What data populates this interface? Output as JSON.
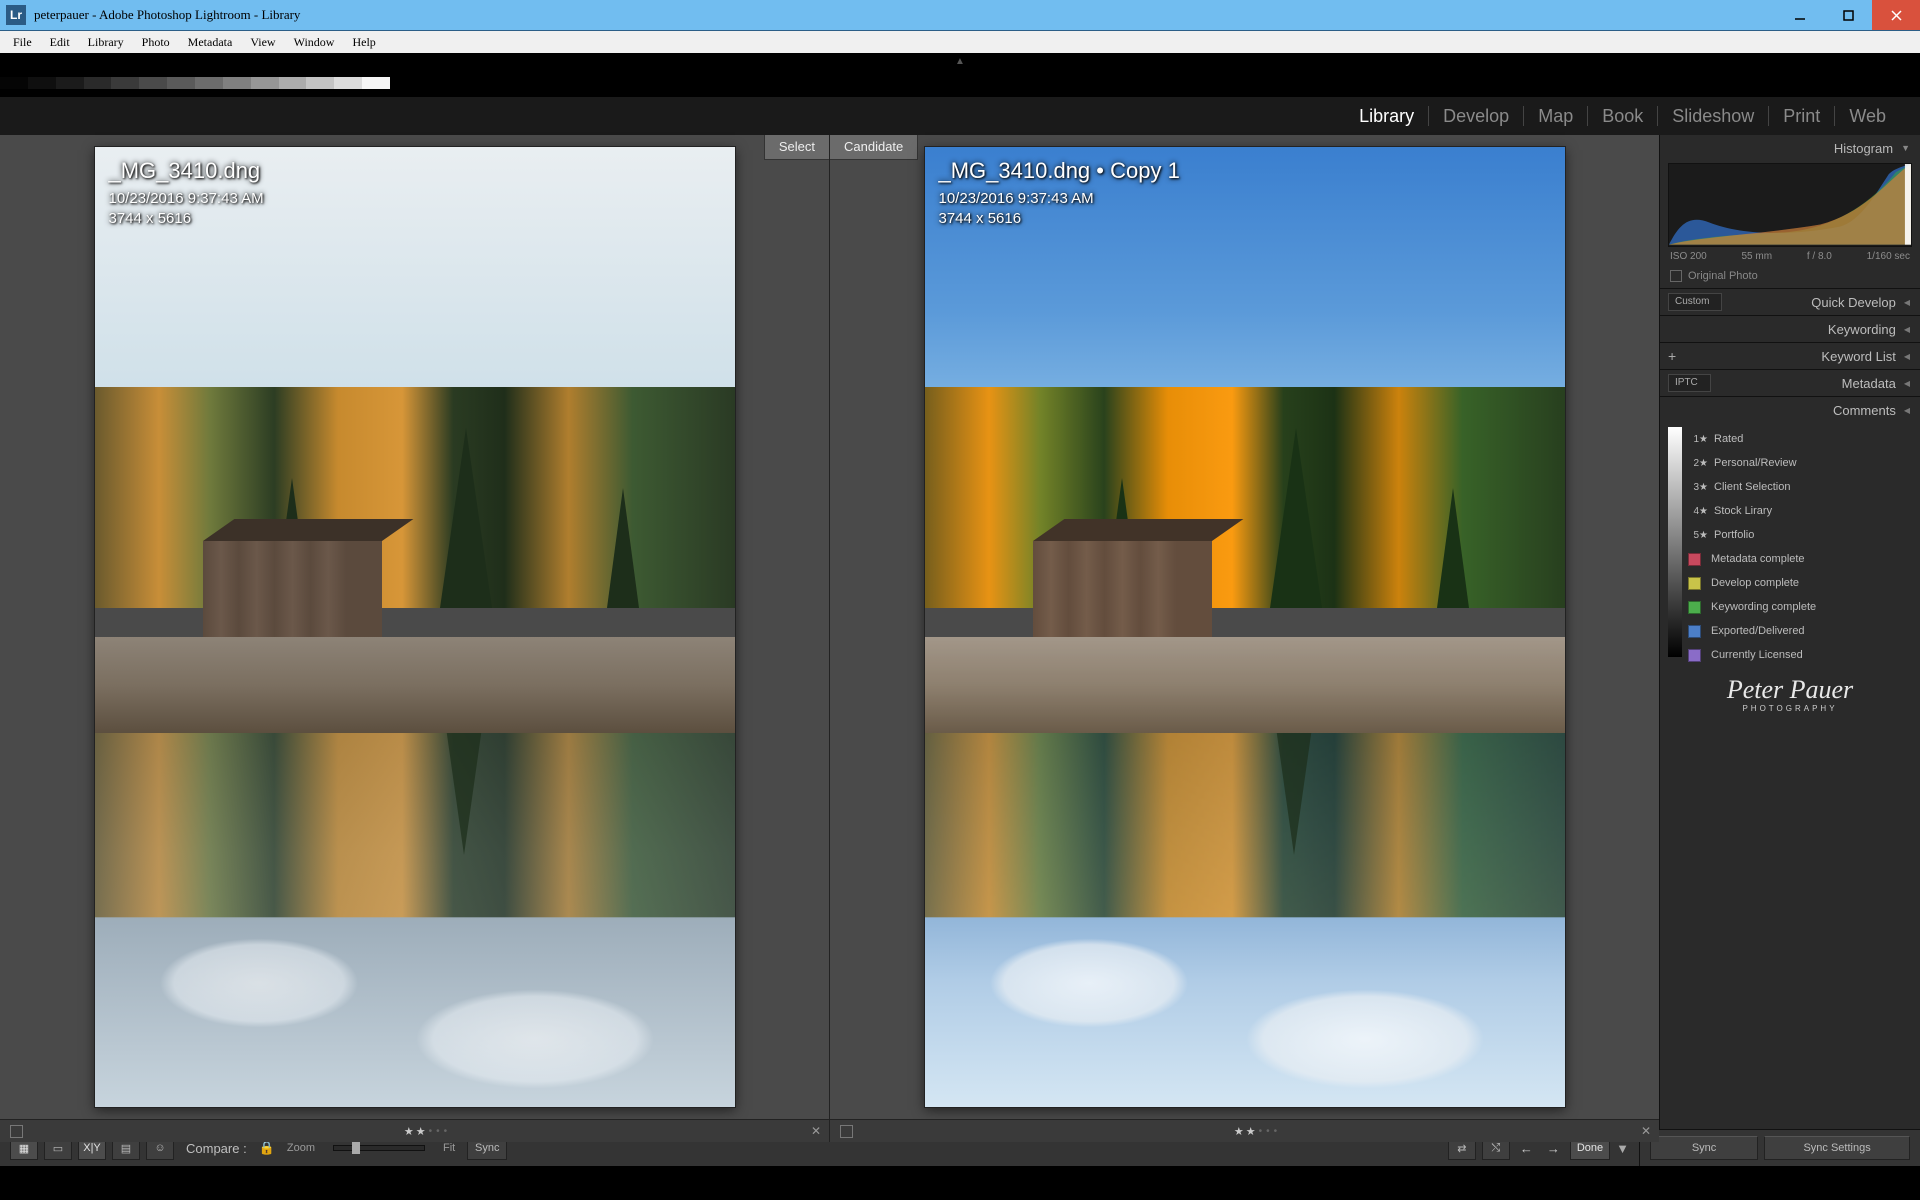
{
  "window_title": "peterpauer - Adobe Photoshop Lightroom - Library",
  "menu": [
    "File",
    "Edit",
    "Library",
    "Photo",
    "Metadata",
    "View",
    "Window",
    "Help"
  ],
  "modules": [
    "Library",
    "Develop",
    "Map",
    "Book",
    "Slideshow",
    "Print",
    "Web"
  ],
  "active_module": "Library",
  "select_tag": "Select",
  "candidate_tag": "Candidate",
  "left_image": {
    "filename": "_MG_3410.dng",
    "datetime": "10/23/2016 9:37:43 AM",
    "dimensions": "3744 x 5616"
  },
  "right_image": {
    "filename": "_MG_3410.dng  •  Copy 1",
    "datetime": "10/23/2016 9:37:43 AM",
    "dimensions": "3744 x 5616"
  },
  "panels": {
    "histogram": "Histogram",
    "quickdevelop": "Quick Develop",
    "quickdevelop_preset": "Custom",
    "keywording": "Keywording",
    "keywordlist": "Keyword List",
    "metadata": "Metadata",
    "metadata_preset": "IPTC",
    "comments": "Comments"
  },
  "histogram_meta": {
    "iso": "ISO 200",
    "focal": "55 mm",
    "aperture": "f / 8.0",
    "shutter": "1/160 sec"
  },
  "original_photo_label": "Original Photo",
  "color_labels": [
    {
      "star": "1★",
      "text": "Rated"
    },
    {
      "star": "2★",
      "text": "Personal/Review"
    },
    {
      "star": "3★",
      "text": "Client Selection"
    },
    {
      "star": "4★",
      "text": "Stock Lirary"
    },
    {
      "star": "5★",
      "text": "Portfolio"
    },
    {
      "color": "#c8495e",
      "text": "Metadata complete"
    },
    {
      "color": "#c8c349",
      "text": "Develop complete"
    },
    {
      "color": "#4cae4c",
      "text": "Keywording complete"
    },
    {
      "color": "#4c7fc8",
      "text": "Exported/Delivered"
    },
    {
      "color": "#8a6cc8",
      "text": "Currently Licensed"
    }
  ],
  "identity": {
    "name": "Peter  Pauer",
    "sub": "PHOTOGRAPHY"
  },
  "toolbar": {
    "compare": "Compare :",
    "zoom": "Zoom",
    "fit": "Fit",
    "sync_zoom": "Sync",
    "done": "Done",
    "sync": "Sync",
    "sync_settings": "Sync Settings"
  }
}
